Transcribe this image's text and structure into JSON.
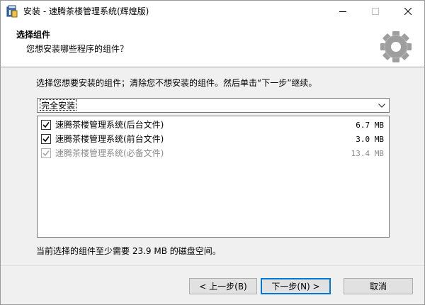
{
  "window": {
    "title": "安装 - 速腾茶楼管理系统(辉煌版)"
  },
  "header": {
    "title": "选择组件",
    "subtitle": "您想安装哪些程序的组件？",
    "icon": "gear-icon"
  },
  "main": {
    "instruction": "选择您想要安装的组件；清除您不想安装的组件。然后单击“下一步”继续。",
    "setup_type": {
      "selected": "完全安装"
    },
    "components": [
      {
        "name": "速腾茶楼管理系统(后台文件)",
        "size": "6.7 MB",
        "checked": true,
        "enabled": true
      },
      {
        "name": "速腾茶楼管理系统(前台文件)",
        "size": "3.0 MB",
        "checked": true,
        "enabled": true
      },
      {
        "name": "速腾茶楼管理系统(必备文件)",
        "size": "13.4 MB",
        "checked": true,
        "enabled": false
      }
    ],
    "disk_space": "当前选择的组件至少需要 23.9 MB 的磁盘空间。"
  },
  "buttons": {
    "back": "< 上一步(B)",
    "next": "下一步(N) >",
    "cancel": "取消"
  },
  "colors": {
    "accent": "#0078d7",
    "panel": "#f0f0f0",
    "disabled_text": "#8c8c8c"
  }
}
